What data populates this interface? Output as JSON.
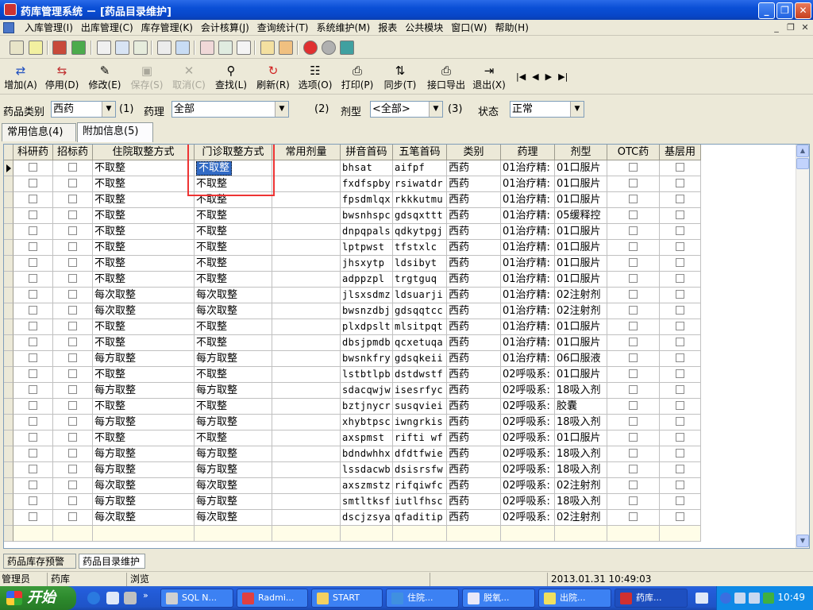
{
  "window": {
    "title": "药库管理系统 － [药品目录维护]"
  },
  "menu": [
    "入库管理(I)",
    "出库管理(C)",
    "库存管理(K)",
    "会计核算(J)",
    "查询统计(T)",
    "系统维护(M)",
    "报表",
    "公共模块",
    "窗口(W)",
    "帮助(H)"
  ],
  "toolbar": [
    {
      "label": "增加(A)",
      "icon": "add-icon",
      "disabled": false
    },
    {
      "label": "停用(D)",
      "icon": "disable-icon",
      "disabled": false
    },
    {
      "label": "修改(E)",
      "icon": "edit-icon",
      "disabled": false
    },
    {
      "label": "保存(S)",
      "icon": "save-icon",
      "disabled": true
    },
    {
      "label": "取消(C)",
      "icon": "cancel-icon",
      "disabled": true
    },
    {
      "label": "查找(L)",
      "icon": "search-icon",
      "disabled": false
    },
    {
      "label": "刷新(R)",
      "icon": "refresh-icon",
      "disabled": false
    },
    {
      "label": "选项(O)",
      "icon": "options-icon",
      "disabled": false
    },
    {
      "label": "打印(P)",
      "icon": "print-icon",
      "disabled": false
    },
    {
      "label": "同步(T)",
      "icon": "sync-icon",
      "disabled": false
    },
    {
      "label": "接口导出",
      "icon": "export-icon",
      "disabled": false
    },
    {
      "label": "退出(X)",
      "icon": "exit-icon",
      "disabled": false
    }
  ],
  "filters": {
    "category_label": "药品类别",
    "category_value": "西药",
    "category_key": "(1)",
    "pharma_label": "药理",
    "pharma_value": "全部",
    "form_key": "(2)",
    "form_label": "剂型",
    "form_value": "<全部>",
    "status_key": "(3)",
    "status_label": "状态",
    "status_value": "正常"
  },
  "tabs": [
    "常用信息(4)",
    "附加信息(5)"
  ],
  "columns": [
    "科研药",
    "招标药",
    "住院取整方式",
    "门诊取整方式",
    "常用剂量",
    "拼音首码",
    "五笔首码",
    "类别",
    "药理",
    "剂型",
    "OTC药",
    "基层用"
  ],
  "rows": [
    [
      "不取整",
      "不取整",
      "bhsat",
      "aifpf",
      "西药",
      "01治疗精:",
      "01口服片"
    ],
    [
      "不取整",
      "不取整",
      "fxdfspby",
      "rsiwatdr",
      "西药",
      "01治疗精:",
      "01口服片"
    ],
    [
      "不取整",
      "不取整",
      "fpsdmlqx",
      "rkkkutmu",
      "西药",
      "01治疗精:",
      "01口服片"
    ],
    [
      "不取整",
      "不取整",
      "bwsnhspc",
      "gdsqxttt",
      "西药",
      "01治疗精:",
      "05缓释控"
    ],
    [
      "不取整",
      "不取整",
      "dnpqpals",
      "qdkytpgj",
      "西药",
      "01治疗精:",
      "01口服片"
    ],
    [
      "不取整",
      "不取整",
      "lptpwst",
      "tfstxlc",
      "西药",
      "01治疗精:",
      "01口服片"
    ],
    [
      "不取整",
      "不取整",
      "jhsxytp",
      "ldsibyt",
      "西药",
      "01治疗精:",
      "01口服片"
    ],
    [
      "不取整",
      "不取整",
      "adppzpl",
      "trgtguq",
      "西药",
      "01治疗精:",
      "01口服片"
    ],
    [
      "每次取整",
      "每次取整",
      "jlsxsdmz",
      "ldsuarji",
      "西药",
      "01治疗精:",
      "02注射剂"
    ],
    [
      "每次取整",
      "每次取整",
      "bwsnzdbj",
      "gdsqqtcc",
      "西药",
      "01治疗精:",
      "02注射剂"
    ],
    [
      "不取整",
      "不取整",
      "plxdpslt",
      "mlsitpqt",
      "西药",
      "01治疗精:",
      "01口服片"
    ],
    [
      "不取整",
      "不取整",
      "dbsjpmdb",
      "qcxetuqa",
      "西药",
      "01治疗精:",
      "01口服片"
    ],
    [
      "每方取整",
      "每方取整",
      "bwsnkfry",
      "gdsqkeii",
      "西药",
      "01治疗精:",
      "06口服液"
    ],
    [
      "不取整",
      "不取整",
      "lstbtlpb",
      "dstdwstf",
      "西药",
      "02呼吸系:",
      "01口服片"
    ],
    [
      "每方取整",
      "每方取整",
      "sdacqwjw",
      "isesrfyc",
      "西药",
      "02呼吸系:",
      "18吸入剂"
    ],
    [
      "不取整",
      "不取整",
      "bztjnycr",
      "susqviei",
      "西药",
      "02呼吸系:",
      "胶囊"
    ],
    [
      "每方取整",
      "每方取整",
      "xhybtpsc",
      "iwngrkis",
      "西药",
      "02呼吸系:",
      "18吸入剂"
    ],
    [
      "不取整",
      "不取整",
      "axspmst",
      "rifti wf",
      "西药",
      "02呼吸系:",
      "01口服片"
    ],
    [
      "每方取整",
      "每方取整",
      "bdndwhhx",
      "dfdtfwie",
      "西药",
      "02呼吸系:",
      "18吸入剂"
    ],
    [
      "每方取整",
      "每方取整",
      "lssdacwb",
      "dsisrsfw",
      "西药",
      "02呼吸系:",
      "18吸入剂"
    ],
    [
      "每次取整",
      "每次取整",
      "axszmstz",
      "rifqiwfc",
      "西药",
      "02呼吸系:",
      "02注射剂"
    ],
    [
      "每方取整",
      "每方取整",
      "smtltksf",
      "iutlfhsc",
      "西药",
      "02呼吸系:",
      "18吸入剂"
    ],
    [
      "每次取整",
      "每次取整",
      "dscjzsya",
      "qfaditip",
      "西药",
      "02呼吸系:",
      "02注射剂"
    ]
  ],
  "bottom_tabs": [
    "药品库存预警",
    "药品目录维护"
  ],
  "status": {
    "user": "管理员",
    "dept": "药库",
    "mode": "浏览",
    "datetime": "2013.01.31  10:49:03"
  },
  "taskbar": {
    "start": "开始",
    "tasks": [
      "SQL N...",
      "Radmi...",
      "START",
      "住院...",
      "脱氧...",
      "出院...",
      "药库..."
    ],
    "clock": "10:49"
  }
}
